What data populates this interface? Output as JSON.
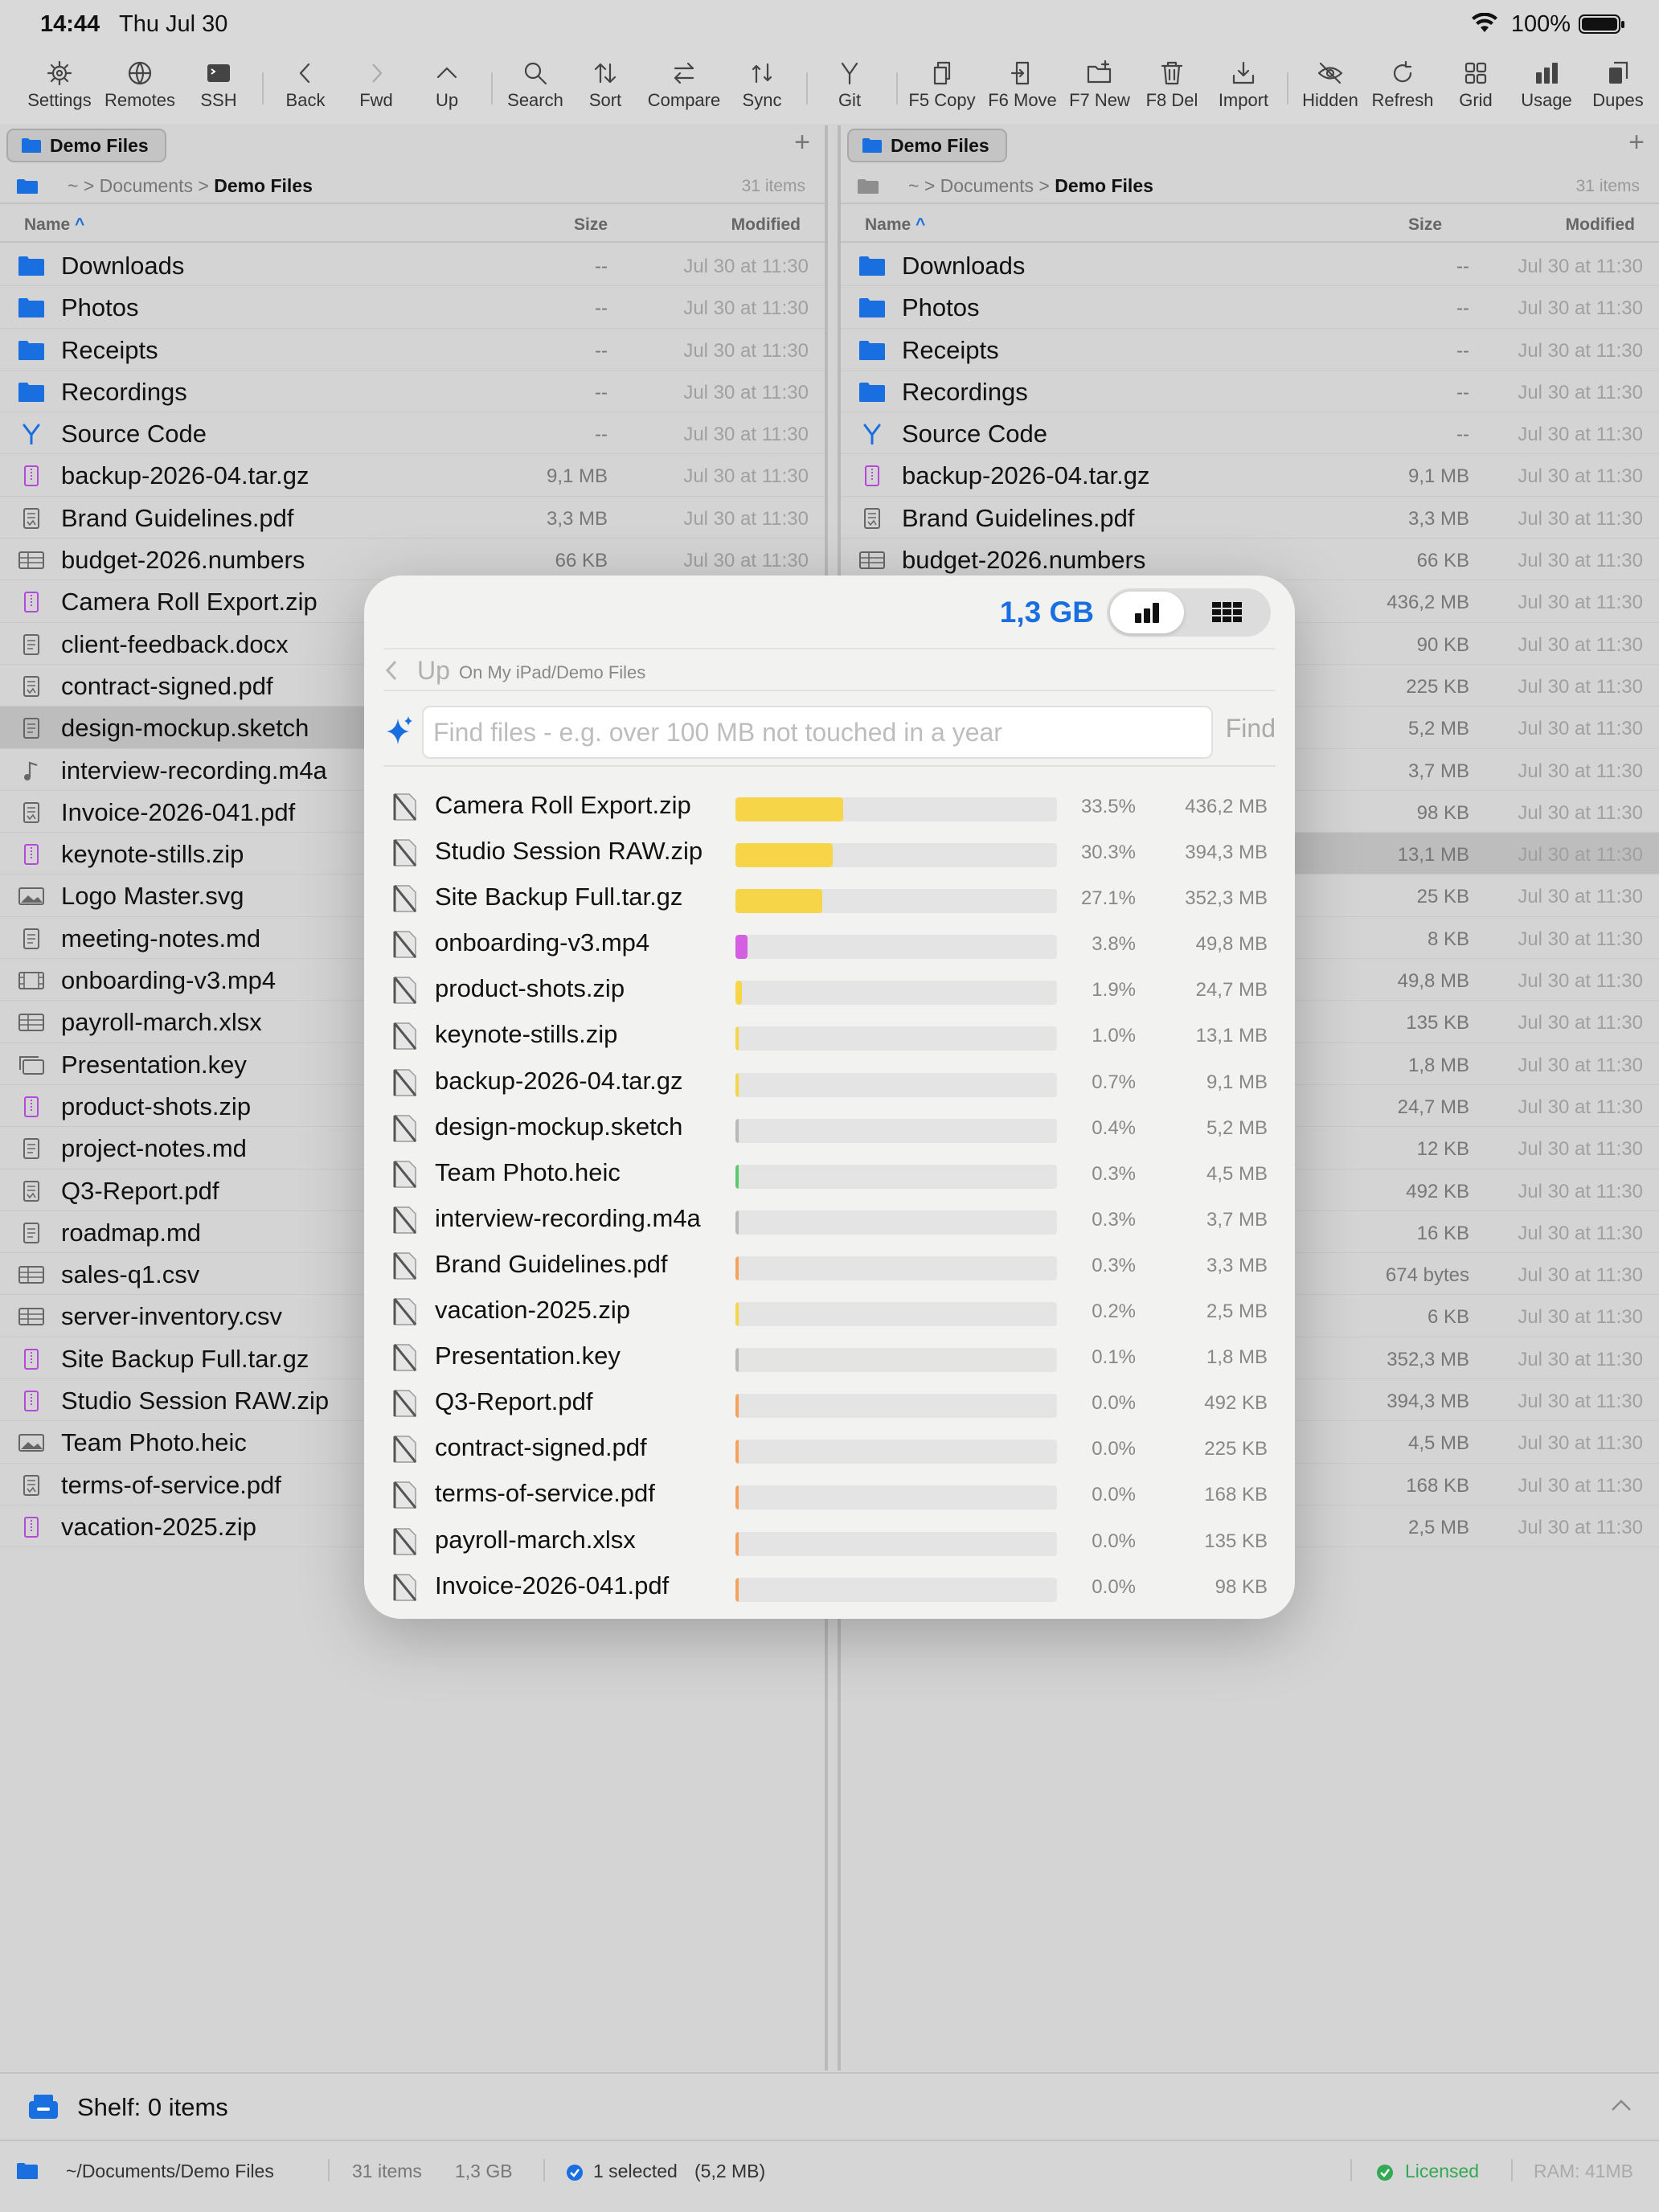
{
  "status": {
    "time": "14:44",
    "date": "Thu Jul 30",
    "battery": "100%"
  },
  "toolbar": [
    {
      "label": "Settings",
      "icon": "gear-icon"
    },
    {
      "label": "Remotes",
      "icon": "globe-icon"
    },
    {
      "label": "SSH",
      "icon": "terminal-icon"
    },
    {
      "label": "Back",
      "icon": "chevron-left-icon"
    },
    {
      "label": "Fwd",
      "icon": "chevron-right-icon"
    },
    {
      "label": "Up",
      "icon": "chevron-up-icon"
    },
    {
      "label": "Search",
      "icon": "search-icon"
    },
    {
      "label": "Sort",
      "icon": "sort-icon"
    },
    {
      "label": "Compare",
      "icon": "compare-icon"
    },
    {
      "label": "Sync",
      "icon": "sync-icon"
    },
    {
      "label": "Git",
      "icon": "git-branch-icon"
    },
    {
      "label": "F5 Copy",
      "icon": "copy-icon"
    },
    {
      "label": "F6 Move",
      "icon": "move-icon"
    },
    {
      "label": "F7 New",
      "icon": "new-folder-icon"
    },
    {
      "label": "F8 Del",
      "icon": "trash-icon"
    },
    {
      "label": "Import",
      "icon": "import-icon"
    },
    {
      "label": "Hidden",
      "icon": "eye-slash-icon"
    },
    {
      "label": "Refresh",
      "icon": "refresh-icon"
    },
    {
      "label": "Grid",
      "icon": "grid-icon"
    },
    {
      "label": "Usage",
      "icon": "bar-chart-icon"
    },
    {
      "label": "Dupes",
      "icon": "duplicates-icon"
    }
  ],
  "left_pane": {
    "tab": "Demo Files",
    "path_home": "~",
    "path_parent": "Documents",
    "path_current": "Demo Files",
    "count": "31 items",
    "col_name": "Name",
    "col_size": "Size",
    "col_modified": "Modified",
    "rows": [
      {
        "name": "Downloads",
        "size": "--",
        "modified": "Jul 30 at 11:30",
        "type": "folder"
      },
      {
        "name": "Photos",
        "size": "--",
        "modified": "Jul 30 at 11:30",
        "type": "folder"
      },
      {
        "name": "Receipts",
        "size": "--",
        "modified": "Jul 30 at 11:30",
        "type": "folder"
      },
      {
        "name": "Recordings",
        "size": "--",
        "modified": "Jul 30 at 11:30",
        "type": "folder"
      },
      {
        "name": "Source Code",
        "size": "--",
        "modified": "Jul 30 at 11:30",
        "type": "git"
      },
      {
        "name": "backup-2026-04.tar.gz",
        "size": "9,1 MB",
        "modified": "Jul 30 at 11:30",
        "type": "zip"
      },
      {
        "name": "Brand Guidelines.pdf",
        "size": "3,3 MB",
        "modified": "Jul 30 at 11:30",
        "type": "pdf"
      },
      {
        "name": "budget-2026.numbers",
        "size": "66 KB",
        "modified": "Jul 30 at 11:30",
        "type": "table"
      },
      {
        "name": "Camera Roll Export.zip",
        "size": "",
        "modified": "",
        "type": "zip"
      },
      {
        "name": "client-feedback.docx",
        "size": "",
        "modified": "",
        "type": "doc"
      },
      {
        "name": "contract-signed.pdf",
        "size": "",
        "modified": "",
        "type": "pdf"
      },
      {
        "name": "design-mockup.sketch",
        "size": "",
        "modified": "",
        "type": "doc",
        "selected": true
      },
      {
        "name": "interview-recording.m4a",
        "size": "",
        "modified": "",
        "type": "audio"
      },
      {
        "name": "Invoice-2026-041.pdf",
        "size": "",
        "modified": "",
        "type": "pdf"
      },
      {
        "name": "keynote-stills.zip",
        "size": "",
        "modified": "",
        "type": "zip"
      },
      {
        "name": "Logo Master.svg",
        "size": "",
        "modified": "",
        "type": "image"
      },
      {
        "name": "meeting-notes.md",
        "size": "",
        "modified": "",
        "type": "doc"
      },
      {
        "name": "onboarding-v3.mp4",
        "size": "",
        "modified": "",
        "type": "video"
      },
      {
        "name": "payroll-march.xlsx",
        "size": "",
        "modified": "",
        "type": "table"
      },
      {
        "name": "Presentation.key",
        "size": "",
        "modified": "",
        "type": "slides"
      },
      {
        "name": "product-shots.zip",
        "size": "",
        "modified": "",
        "type": "zip"
      },
      {
        "name": "project-notes.md",
        "size": "",
        "modified": "",
        "type": "doc"
      },
      {
        "name": "Q3-Report.pdf",
        "size": "",
        "modified": "",
        "type": "pdf"
      },
      {
        "name": "roadmap.md",
        "size": "",
        "modified": "",
        "type": "doc"
      },
      {
        "name": "sales-q1.csv",
        "size": "",
        "modified": "",
        "type": "table"
      },
      {
        "name": "server-inventory.csv",
        "size": "",
        "modified": "",
        "type": "table"
      },
      {
        "name": "Site Backup Full.tar.gz",
        "size": "",
        "modified": "",
        "type": "zip"
      },
      {
        "name": "Studio Session RAW.zip",
        "size": "",
        "modified": "",
        "type": "zip"
      },
      {
        "name": "Team Photo.heic",
        "size": "",
        "modified": "",
        "type": "image"
      },
      {
        "name": "terms-of-service.pdf",
        "size": "",
        "modified": "",
        "type": "pdf"
      },
      {
        "name": "vacation-2025.zip",
        "size": "",
        "modified": "",
        "type": "zip"
      }
    ]
  },
  "right_pane": {
    "tab": "Demo Files",
    "path_home": "~",
    "path_parent": "Documents",
    "path_current": "Demo Files",
    "count": "31 items",
    "col_name": "Name",
    "col_size": "Size",
    "col_modified": "Modified",
    "rows": [
      {
        "name": "Downloads",
        "size": "--",
        "modified": "Jul 30 at 11:30",
        "type": "folder"
      },
      {
        "name": "Photos",
        "size": "--",
        "modified": "Jul 30 at 11:30",
        "type": "folder"
      },
      {
        "name": "Receipts",
        "size": "--",
        "modified": "Jul 30 at 11:30",
        "type": "folder"
      },
      {
        "name": "Recordings",
        "size": "--",
        "modified": "Jul 30 at 11:30",
        "type": "folder"
      },
      {
        "name": "Source Code",
        "size": "--",
        "modified": "Jul 30 at 11:30",
        "type": "git"
      },
      {
        "name": "backup-2026-04.tar.gz",
        "size": "9,1 MB",
        "modified": "Jul 30 at 11:30",
        "type": "zip"
      },
      {
        "name": "Brand Guidelines.pdf",
        "size": "3,3 MB",
        "modified": "Jul 30 at 11:30",
        "type": "pdf"
      },
      {
        "name": "budget-2026.numbers",
        "size": "66 KB",
        "modified": "Jul 30 at 11:30",
        "type": "table"
      },
      {
        "name": "",
        "size": "436,2 MB",
        "modified": "Jul 30 at 11:30",
        "type": "none"
      },
      {
        "name": "",
        "size": "90 KB",
        "modified": "Jul 30 at 11:30",
        "type": "none"
      },
      {
        "name": "",
        "size": "225 KB",
        "modified": "Jul 30 at 11:30",
        "type": "none"
      },
      {
        "name": "",
        "size": "5,2 MB",
        "modified": "Jul 30 at 11:30",
        "type": "none"
      },
      {
        "name": "",
        "size": "3,7 MB",
        "modified": "Jul 30 at 11:30",
        "type": "none"
      },
      {
        "name": "",
        "size": "98 KB",
        "modified": "Jul 30 at 11:30",
        "type": "none"
      },
      {
        "name": "",
        "size": "13,1 MB",
        "modified": "Jul 30 at 11:30",
        "type": "none",
        "selected": true
      },
      {
        "name": "",
        "size": "25 KB",
        "modified": "Jul 30 at 11:30",
        "type": "none"
      },
      {
        "name": "",
        "size": "8 KB",
        "modified": "Jul 30 at 11:30",
        "type": "none"
      },
      {
        "name": "",
        "size": "49,8 MB",
        "modified": "Jul 30 at 11:30",
        "type": "none"
      },
      {
        "name": "",
        "size": "135 KB",
        "modified": "Jul 30 at 11:30",
        "type": "none"
      },
      {
        "name": "",
        "size": "1,8 MB",
        "modified": "Jul 30 at 11:30",
        "type": "none"
      },
      {
        "name": "",
        "size": "24,7 MB",
        "modified": "Jul 30 at 11:30",
        "type": "none"
      },
      {
        "name": "",
        "size": "12 KB",
        "modified": "Jul 30 at 11:30",
        "type": "none"
      },
      {
        "name": "",
        "size": "492 KB",
        "modified": "Jul 30 at 11:30",
        "type": "none"
      },
      {
        "name": "",
        "size": "16 KB",
        "modified": "Jul 30 at 11:30",
        "type": "none"
      },
      {
        "name": "",
        "size": "674 bytes",
        "modified": "Jul 30 at 11:30",
        "type": "none"
      },
      {
        "name": "",
        "size": "6 KB",
        "modified": "Jul 30 at 11:30",
        "type": "none"
      },
      {
        "name": "",
        "size": "352,3 MB",
        "modified": "Jul 30 at 11:30",
        "type": "none"
      },
      {
        "name": "",
        "size": "394,3 MB",
        "modified": "Jul 30 at 11:30",
        "type": "none"
      },
      {
        "name": "",
        "size": "4,5 MB",
        "modified": "Jul 30 at 11:30",
        "type": "none"
      },
      {
        "name": "",
        "size": "168 KB",
        "modified": "Jul 30 at 11:30",
        "type": "none"
      },
      {
        "name": "",
        "size": "2,5 MB",
        "modified": "Jul 30 at 11:30",
        "type": "none"
      }
    ]
  },
  "usage": {
    "total": "1,3 GB",
    "up_label": "Up",
    "path": "On My iPad/Demo Files",
    "find_placeholder": "Find files - e.g. over 100 MB not touched in a year",
    "find_button": "Find",
    "items": [
      {
        "name": "Camera Roll Export.zip",
        "pct": "33.5%",
        "fraction": 0.335,
        "size": "436,2 MB",
        "color": "#f6d548"
      },
      {
        "name": "Studio Session RAW.zip",
        "pct": "30.3%",
        "fraction": 0.303,
        "size": "394,3 MB",
        "color": "#f6d548"
      },
      {
        "name": "Site Backup Full.tar.gz",
        "pct": "27.1%",
        "fraction": 0.271,
        "size": "352,3 MB",
        "color": "#f6d548"
      },
      {
        "name": "onboarding-v3.mp4",
        "pct": "3.8%",
        "fraction": 0.038,
        "size": "49,8 MB",
        "color": "#d45fe0"
      },
      {
        "name": "product-shots.zip",
        "pct": "1.9%",
        "fraction": 0.019,
        "size": "24,7 MB",
        "color": "#f6d548"
      },
      {
        "name": "keynote-stills.zip",
        "pct": "1.0%",
        "fraction": 0.01,
        "size": "13,1 MB",
        "color": "#f6d548"
      },
      {
        "name": "backup-2026-04.tar.gz",
        "pct": "0.7%",
        "fraction": 0.007,
        "size": "9,1 MB",
        "color": "#f6d548"
      },
      {
        "name": "design-mockup.sketch",
        "pct": "0.4%",
        "fraction": 0.004,
        "size": "5,2 MB",
        "color": "#b9b9b9"
      },
      {
        "name": "Team Photo.heic",
        "pct": "0.3%",
        "fraction": 0.003,
        "size": "4,5 MB",
        "color": "#5cc96a"
      },
      {
        "name": "interview-recording.m4a",
        "pct": "0.3%",
        "fraction": 0.003,
        "size": "3,7 MB",
        "color": "#b9b9b9"
      },
      {
        "name": "Brand Guidelines.pdf",
        "pct": "0.3%",
        "fraction": 0.003,
        "size": "3,3 MB",
        "color": "#f5a25a"
      },
      {
        "name": "vacation-2025.zip",
        "pct": "0.2%",
        "fraction": 0.002,
        "size": "2,5 MB",
        "color": "#f6d548"
      },
      {
        "name": "Presentation.key",
        "pct": "0.1%",
        "fraction": 0.001,
        "size": "1,8 MB",
        "color": "#b9b9b9"
      },
      {
        "name": "Q3-Report.pdf",
        "pct": "0.0%",
        "fraction": 0.0,
        "size": "492 KB",
        "color": "#f5a25a"
      },
      {
        "name": "contract-signed.pdf",
        "pct": "0.0%",
        "fraction": 0.0,
        "size": "225 KB",
        "color": "#f5a25a"
      },
      {
        "name": "terms-of-service.pdf",
        "pct": "0.0%",
        "fraction": 0.0,
        "size": "168 KB",
        "color": "#f5a25a"
      },
      {
        "name": "payroll-march.xlsx",
        "pct": "0.0%",
        "fraction": 0.0,
        "size": "135 KB",
        "color": "#f5a25a"
      },
      {
        "name": "Invoice-2026-041.pdf",
        "pct": "0.0%",
        "fraction": 0.0,
        "size": "98 KB",
        "color": "#f5a25a"
      }
    ]
  },
  "shelf": {
    "label": "Shelf: 0 items"
  },
  "footer": {
    "path": "~/Documents/Demo Files",
    "items": "31 items",
    "size": "1,3 GB",
    "selected": "1 selected",
    "selected_size": "(5,2 MB)",
    "license": "Licensed",
    "ram": "RAM: 41MB"
  },
  "colors": {
    "accent": "#1a6fe0",
    "folder": "#1a6fe0",
    "zip_icon": "#b44ad8",
    "licensed": "#34a853"
  }
}
